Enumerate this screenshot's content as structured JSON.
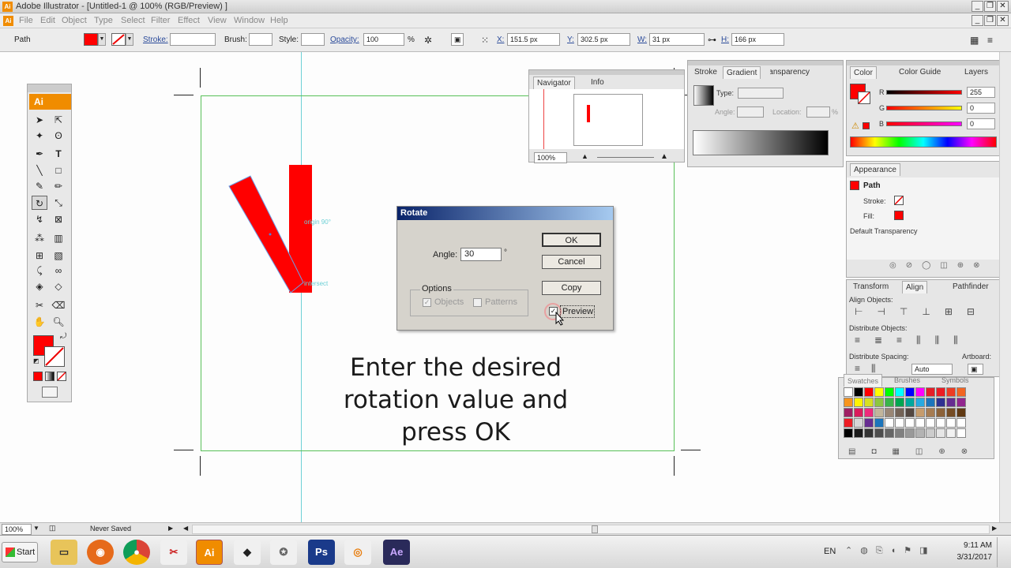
{
  "window": {
    "title": "Adobe Illustrator - [Untitled-1 @ 100% (RGB/Preview) ]",
    "app_icon": "Ai",
    "buttons": [
      "_",
      "❐",
      "✕"
    ]
  },
  "menu": [
    "File",
    "Edit",
    "Object",
    "Type",
    "Select",
    "Filter",
    "Effect",
    "View",
    "Window",
    "Help"
  ],
  "controlbar": {
    "selection_type": "Path",
    "stroke_label": "Stroke:",
    "brush_label": "Brush:",
    "style_label": "Style:",
    "opacity_label": "Opacity:",
    "opacity_value": "100",
    "opacity_unit": "%",
    "x_label": "X:",
    "x_value": "151.5 px",
    "y_label": "Y:",
    "y_value": "302.5 px",
    "w_label": "W:",
    "w_value": "31 px",
    "h_label": "H:",
    "h_value": "166 px",
    "fill_color": "#ff0000"
  },
  "canvas": {
    "origin_label": "origin 90°",
    "intersect_label": "intersect",
    "shape_color": "#ff0000"
  },
  "tools": {
    "logo": "Ai",
    "fill_color": "#ff0000"
  },
  "navigator": {
    "tabs": [
      "Navigator",
      "Info"
    ],
    "zoom": "100%"
  },
  "gradient_panel": {
    "tabs": [
      "Stroke",
      "Gradient",
      "Transparency"
    ],
    "type_label": "Type:",
    "angle_label": "Angle:",
    "location_label": "Location:",
    "percent": "%"
  },
  "color_panel": {
    "tabs": [
      "Color",
      "Color Guide",
      "Layers"
    ],
    "r_label": "R",
    "g_label": "G",
    "b_label": "B",
    "r_value": "255",
    "g_value": "0",
    "b_value": "0"
  },
  "appearance": {
    "tab": "Appearance",
    "title": "Path",
    "stroke_label": "Stroke:",
    "fill_label": "Fill:",
    "default_transparency": "Default Transparency"
  },
  "align_panel": {
    "tabs": [
      "Transform",
      "Align",
      "Pathfinder"
    ],
    "align_objects": "Align Objects:",
    "distribute_objects": "Distribute Objects:",
    "distribute_spacing": "Distribute Spacing:",
    "artboard": "Artboard:",
    "auto": "Auto"
  },
  "swatches": {
    "tabs": [
      "Swatches",
      "Brushes",
      "Symbols"
    ],
    "colors": [
      "#ffffff",
      "#000000",
      "#ff0000",
      "#ffff00",
      "#00ff00",
      "#00ffff",
      "#0000ff",
      "#ff00ff",
      "#e61e28",
      "#ec1c24",
      "#ee3b24",
      "#f26522",
      "#f7941d",
      "#fff200",
      "#d7df23",
      "#8dc63f",
      "#39b54a",
      "#00a651",
      "#00a79d",
      "#27aae1",
      "#1c75bc",
      "#2e3192",
      "#662d91",
      "#92278f",
      "#9e1f63",
      "#da1c5c",
      "#ee2a7b",
      "#c2b59b",
      "#998675",
      "#736357",
      "#534741",
      "#c69c6d",
      "#a67c52",
      "#8c6239",
      "#754c24",
      "#603913",
      "#ed1c24",
      "#d6d6d6",
      "#662d91",
      "#1c75bc",
      "#ffffff",
      "#ffffff",
      "#ffffff",
      "#ffffff",
      "#ffffff",
      "#ffffff",
      "#ffffff",
      "#ffffff",
      "#000000",
      "#1a1a1a",
      "#333333",
      "#4d4d4d",
      "#666666",
      "#808080",
      "#999999",
      "#b3b3b3",
      "#cccccc",
      "#e6e6e6",
      "#f2f2f2",
      "#ffffff"
    ]
  },
  "dialog": {
    "title": "Rotate",
    "angle_label": "Angle:",
    "angle_value": "30",
    "degree": "°",
    "ok": "OK",
    "cancel": "Cancel",
    "copy": "Copy",
    "preview": "Preview",
    "options_label": "Options",
    "objects": "Objects",
    "patterns": "Patterns"
  },
  "caption": {
    "line1": "Enter the desired",
    "line2": "rotation value and",
    "line3": "press OK"
  },
  "statusbar": {
    "zoom": "100%",
    "status": "Never Saved"
  },
  "taskbar": {
    "start": "Start",
    "lang": "EN",
    "time": "9:11 AM",
    "date": "3/31/2017",
    "apps": [
      "explorer-icon",
      "firefox-icon",
      "chrome-icon",
      "snipping-icon",
      "illustrator-icon",
      "inkscape-icon",
      "gimp-icon",
      "photoshop-icon",
      "blender-icon",
      "aftereffects-icon"
    ]
  }
}
